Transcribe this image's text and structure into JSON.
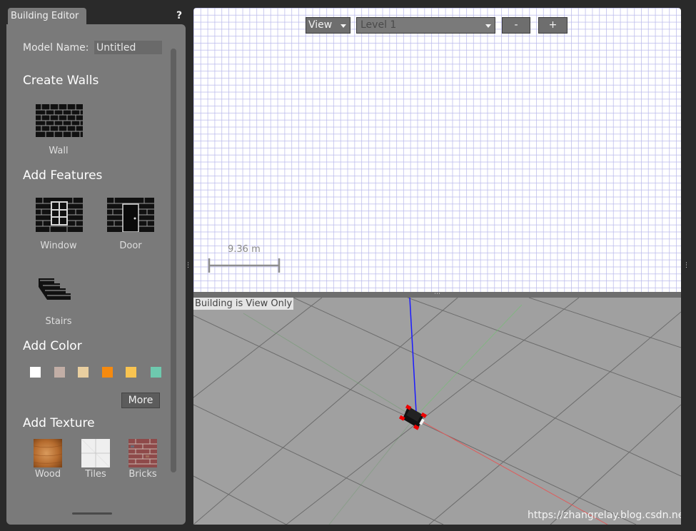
{
  "panel": {
    "tab_label": "Building Editor",
    "help_label": "?",
    "model_name_label": "Model Name:",
    "model_name_value": "Untitled",
    "create_walls": {
      "heading": "Create Walls",
      "wall_label": "Wall"
    },
    "add_features": {
      "heading": "Add Features",
      "window_label": "Window",
      "door_label": "Door",
      "stairs_label": "Stairs"
    },
    "add_color": {
      "heading": "Add Color",
      "swatches": [
        "#ffffff",
        "#c2aea6",
        "#e9cfa0",
        "#f58a0f",
        "#f9c451",
        "#6ec9ae"
      ],
      "more_label": "More"
    },
    "add_texture": {
      "heading": "Add Texture",
      "items": [
        "Wood",
        "Tiles",
        "Bricks"
      ]
    }
  },
  "view2d": {
    "view_dropdown": "View",
    "level_dropdown": "Level 1",
    "minus_label": "-",
    "plus_label": "+",
    "scale_label": "9.36 m"
  },
  "view3d": {
    "status_label": "Building is View Only",
    "watermark": "https://zhangrelay.blog.csdn.net"
  },
  "colors": {
    "panel": "#7a7a7a",
    "grid": "#b9b9eb",
    "ground": "#a0a0a0",
    "axis_x": "#e05a5a",
    "axis_y": "#6fc26f",
    "axis_z": "#1a1aff"
  }
}
